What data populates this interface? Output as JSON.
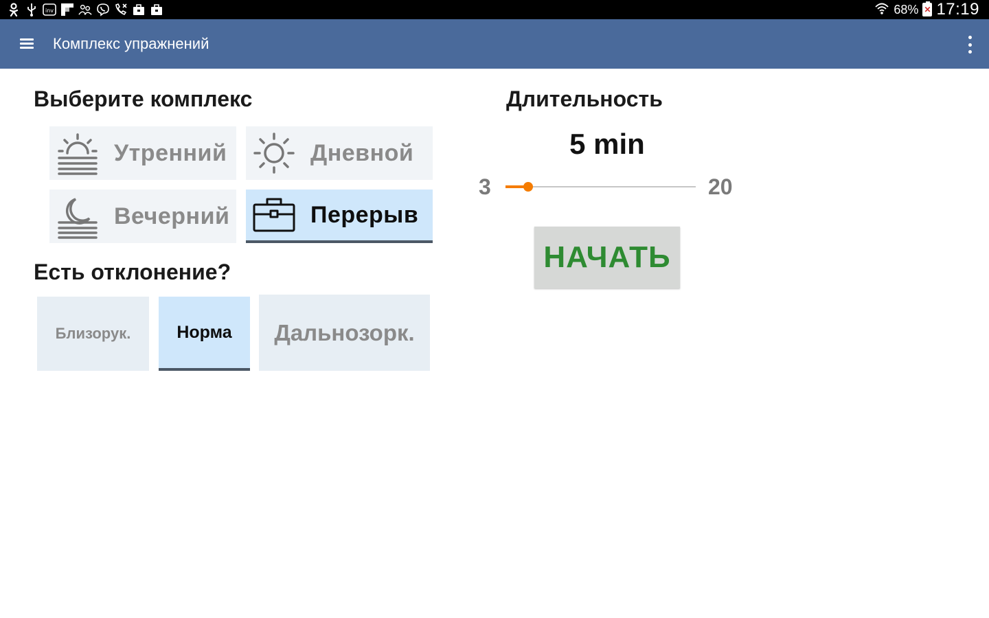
{
  "status_bar": {
    "icons": [
      "odnoklassniki-icon",
      "usb-icon",
      "inv-icon",
      "flipboard-icon",
      "people-icon",
      "viber-icon",
      "missed-call-icon",
      "bag-icon",
      "bag-icon-2"
    ],
    "battery": "68%",
    "time": "17:19"
  },
  "app_bar": {
    "title": "Комплекс упражнений",
    "color": "#4a6a9b"
  },
  "complex": {
    "heading": "Выберите комплекс",
    "items": [
      {
        "label": "Утренний",
        "icon": "sunrise-icon",
        "selected": false
      },
      {
        "label": "Дневной",
        "icon": "sun-icon",
        "selected": false
      },
      {
        "label": "Вечерний",
        "icon": "moon-fog-icon",
        "selected": false
      },
      {
        "label": "Перерыв",
        "icon": "briefcase-icon",
        "selected": true
      }
    ]
  },
  "deviation": {
    "heading": "Есть отклонение?",
    "items": [
      {
        "label": "Близорук.",
        "selected": false
      },
      {
        "label": "Норма",
        "selected": true
      },
      {
        "label": "Дальнозорк.",
        "selected": false
      }
    ]
  },
  "duration": {
    "heading": "Длительность",
    "value_label": "5 min",
    "value": 5,
    "min_label": "3",
    "max_label": "20",
    "min": 3,
    "max": 20,
    "accent": "#f57c00"
  },
  "start_button": {
    "label": "НАЧАТЬ",
    "color": "#2e8b32"
  }
}
